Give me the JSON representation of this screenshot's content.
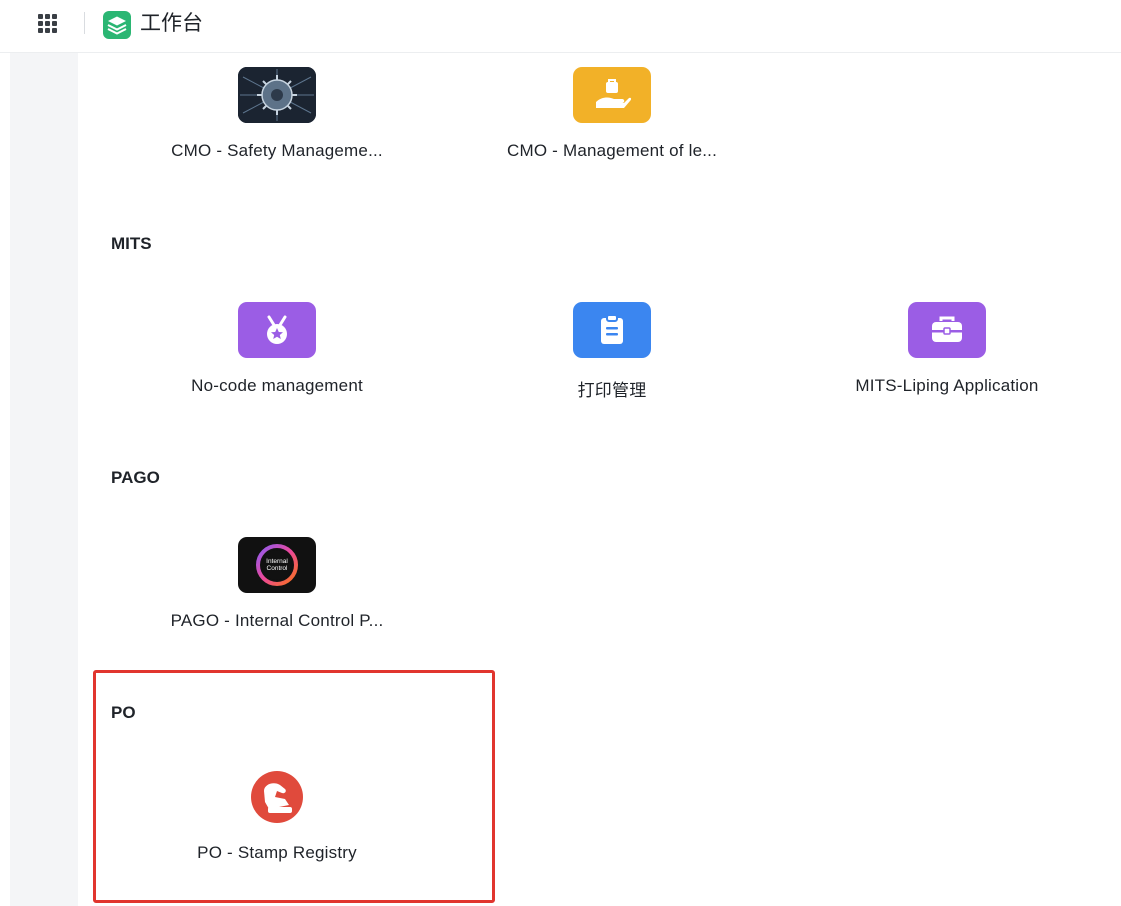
{
  "header": {
    "title": "工作台",
    "icons": {
      "apps": "apps-grid-icon",
      "logo": "workbench-logo-icon"
    }
  },
  "groups": [
    {
      "title": "",
      "apps": [
        {
          "label": "CMO - Safety Manageme...",
          "icon": "virus-network-icon",
          "color": "#1e2a38"
        },
        {
          "label": "CMO - Management of le...",
          "icon": "hand-bag-icon",
          "color": "#f2b128"
        }
      ]
    },
    {
      "title": "MITS",
      "apps": [
        {
          "label": "No-code management",
          "icon": "medal-icon",
          "color": "#9b5de5"
        },
        {
          "label": "打印管理",
          "icon": "clipboard-icon",
          "color": "#3b86f0"
        },
        {
          "label": "MITS-Liping Application",
          "icon": "briefcase-icon",
          "color": "#9b5de5"
        }
      ]
    },
    {
      "title": "PAGO",
      "apps": [
        {
          "label": "PAGO - Internal Control P...",
          "icon": "internal-control-icon",
          "icon_text": "Internal Control",
          "color": "#111111"
        }
      ]
    },
    {
      "title": "PO",
      "apps": [
        {
          "label": "PO - Stamp Registry",
          "icon": "stamp-icon",
          "color": "#e04a3c"
        }
      ]
    }
  ],
  "highlight_color": "#e1352e"
}
